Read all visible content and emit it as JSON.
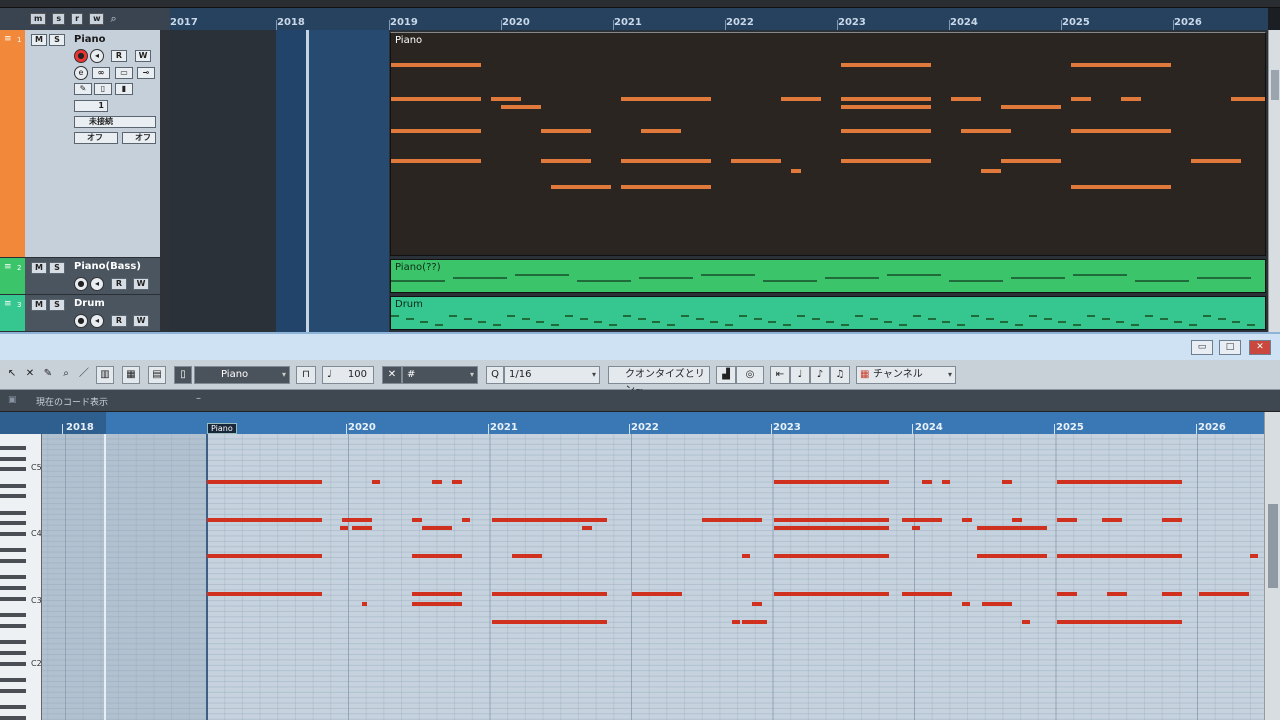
{
  "project": {
    "header_buttons": [
      "m",
      "s",
      "r",
      "w"
    ],
    "ruler_years": [
      "2017",
      "2018",
      "2019",
      "2020",
      "2021",
      "2022",
      "2023",
      "2024",
      "2025",
      "2026"
    ],
    "tracks": [
      {
        "index": "1",
        "name": "Piano",
        "color": "#f2883a",
        "buttons": {
          "mute": "M",
          "solo": "S",
          "read": "R",
          "write": "W"
        },
        "counter": "1",
        "input_label": "未接続",
        "off1": "オフ",
        "off2": "オフ"
      },
      {
        "index": "2",
        "name": "Piano(Bass)",
        "color": "#3cc46a",
        "buttons": {
          "mute": "M",
          "solo": "S",
          "read": "R",
          "write": "W"
        }
      },
      {
        "index": "3",
        "name": "Drum",
        "color": "#36c690",
        "buttons": {
          "mute": "M",
          "solo": "S",
          "read": "R",
          "write": "W"
        }
      }
    ],
    "parts": [
      {
        "name": "Piano"
      },
      {
        "name": "Piano(??)"
      },
      {
        "name": "Drum"
      }
    ]
  },
  "editor": {
    "window_buttons": {
      "minimize": "▭",
      "maximize": "□",
      "close": "✕"
    },
    "toolbar": {
      "track_select": "Piano",
      "velocity": "100",
      "snap_symbol": "#",
      "quantize_label": "Q",
      "quantize_value": "1/16",
      "quantize_mode": "クオンタイズとリン~",
      "color_mode": "チャンネル"
    },
    "chord_track_label": "現在のコード表示",
    "chord_track_value": "–",
    "part_tag": "Piano",
    "ruler_years": [
      "2018",
      "2020",
      "2021",
      "2022",
      "2023",
      "2024",
      "2025",
      "2026"
    ],
    "keyboard_labels": [
      "C5",
      "C4",
      "C3",
      "C2"
    ],
    "accent_color": "#d0301e"
  }
}
